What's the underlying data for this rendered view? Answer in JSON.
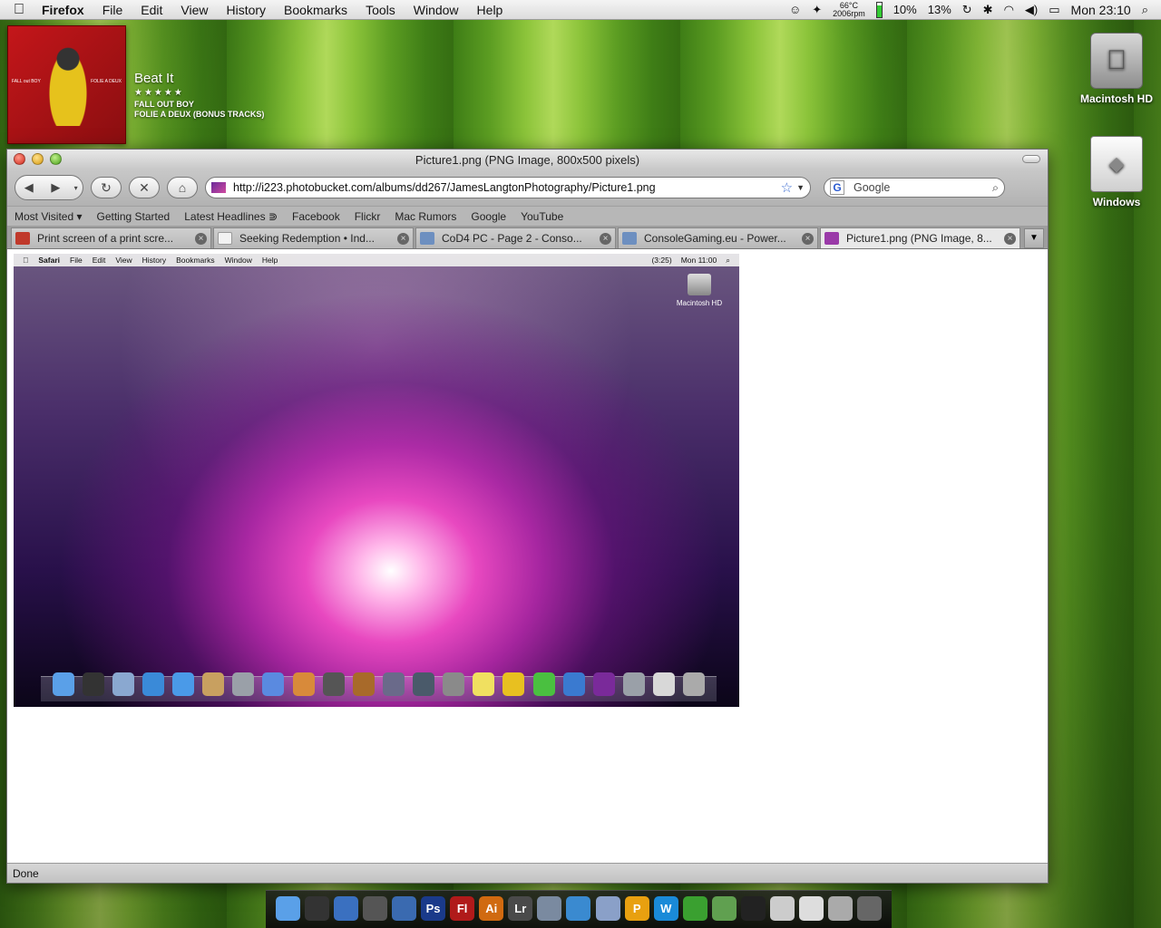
{
  "menubar": {
    "app": "Firefox",
    "items": [
      "File",
      "Edit",
      "View",
      "History",
      "Bookmarks",
      "Tools",
      "Window",
      "Help"
    ],
    "temp": "66°C",
    "fan": "2006rpm",
    "cpu1": "10%",
    "cpu2": "13%",
    "clock": "Mon 23:10"
  },
  "now_playing": {
    "song": "Beat It",
    "rating": "★★★★★",
    "artist": "FALL OUT BOY",
    "album": "FOLIE A DEUX (BONUS TRACKS)",
    "cover_left": "FALL out BOY",
    "cover_right": "FOLIE A DEUX"
  },
  "desktop": {
    "hd_label": "Macintosh HD",
    "windows_label": "Windows"
  },
  "window": {
    "title": "Picture1.png (PNG Image, 800x500 pixels)",
    "url": "http://i223.photobucket.com/albums/dd267/JamesLangtonPhotography/Picture1.png",
    "search_placeholder": "Google",
    "bookmarks": [
      "Most Visited ▾",
      "Getting Started",
      "Latest Headlines ⋑",
      "Facebook",
      "Flickr",
      "Mac Rumors",
      "Google",
      "YouTube"
    ],
    "tabs": [
      {
        "label": "Print screen of a print scre...",
        "color": "#c0392b"
      },
      {
        "label": "Seeking Redemption • Ind...",
        "color": "#f2f2f2"
      },
      {
        "label": "CoD4 PC - Page 2 - Conso...",
        "color": "#6d8fc0"
      },
      {
        "label": "ConsoleGaming.eu - Power...",
        "color": "#6d8fc0"
      },
      {
        "label": "Picture1.png (PNG Image, 8...",
        "color": "#9a3aa8"
      }
    ],
    "status": "Done"
  },
  "screenshot": {
    "app": "Safari",
    "menu": [
      "File",
      "Edit",
      "View",
      "History",
      "Bookmarks",
      "Window",
      "Help"
    ],
    "battery": "(3:25)",
    "clock": "Mon 11:00",
    "hd_label": "Macintosh HD"
  },
  "colors": {
    "desktop_green": "#6aa62a",
    "accent_blue": "#3a6ad0"
  }
}
